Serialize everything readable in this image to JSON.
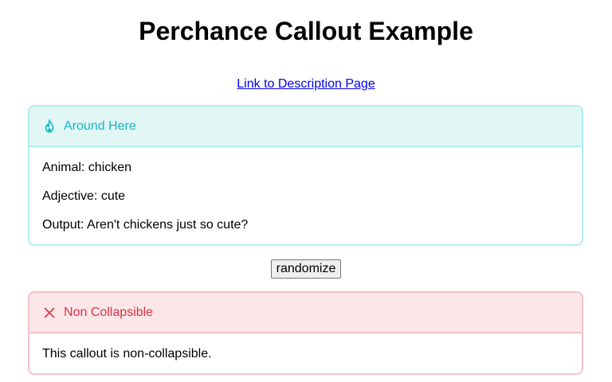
{
  "page": {
    "title": "Perchance Callout Example",
    "description_link": "Link to Description Page"
  },
  "callouts": [
    {
      "title": "Around Here",
      "icon": "flame-icon",
      "accent_color": "#17b6c4",
      "lines": [
        "Animal: chicken",
        "Adjective: cute",
        "Output: Aren't chickens just so cute?"
      ]
    },
    {
      "title": "Non Collapsible",
      "icon": "close-icon",
      "accent_color": "#dc3545",
      "lines": [
        "This callout is non-collapsible."
      ]
    }
  ],
  "controls": {
    "randomize_label": "randomize"
  }
}
